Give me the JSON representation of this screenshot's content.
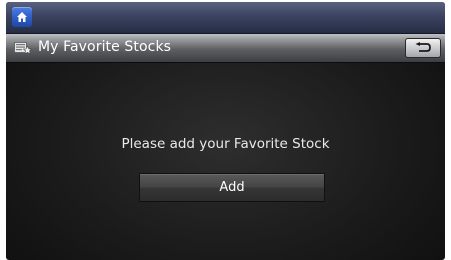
{
  "header": {
    "home_icon": "home-icon",
    "title": "My Favorite Stocks",
    "title_icon": "stocks-icon",
    "back_icon": "back-arrow-icon"
  },
  "main": {
    "message": "Please add your Favorite Stock",
    "add_label": "Add"
  },
  "colors": {
    "topbar": "#3b4360",
    "home_button": "#2f5fc9",
    "background": "#1b1b1b",
    "text": "#ffffff"
  }
}
